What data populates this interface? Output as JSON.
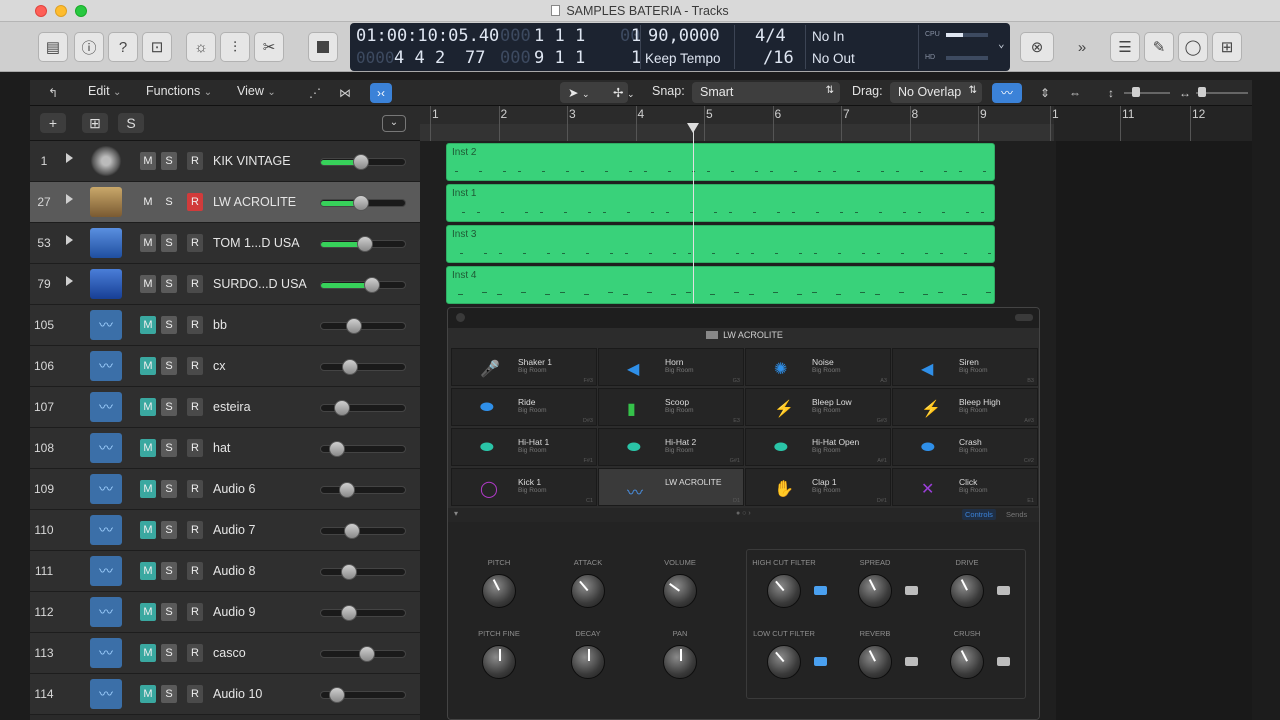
{
  "window": {
    "title": "SAMPLES BATERIA  - Tracks"
  },
  "lcd": {
    "time": "01:00:10:05.40",
    "time_dim": "0000",
    "bars": "1  1  1",
    "bars_end": "1",
    "position": "4  4  2",
    "ticks": "77",
    "pos_dim": "000",
    "pos_bar2": "9  1  1",
    "pos_end2": "1",
    "tempo": "90,0000",
    "tempo_mode": "Keep Tempo",
    "signature": "4/4",
    "division": "/16",
    "midi_in": "No In",
    "midi_out": "No Out",
    "cpu": "CPU",
    "hd": "HD"
  },
  "toolbar": {
    "edit": "Edit",
    "functions": "Functions",
    "view": "View",
    "snap_label": "Snap:",
    "snap_value": "Smart",
    "drag_label": "Drag:",
    "drag_value": "No Overlap"
  },
  "header": {
    "add": "+",
    "add_folder": "⊞",
    "s": "S"
  },
  "tracks": [
    {
      "num": "1",
      "name": "KIK VINTAGE",
      "m": "M",
      "s": "S",
      "r": "R",
      "level": 0.47
    },
    {
      "num": "27",
      "name": "LW ACROLITE",
      "m": "M",
      "s": "S",
      "r": "R",
      "level": 0.47
    },
    {
      "num": "53",
      "name": "TOM 1...D USA",
      "m": "M",
      "s": "S",
      "r": "R",
      "level": 0.51
    },
    {
      "num": "79",
      "name": "SURDO...D USA",
      "m": "M",
      "s": "S",
      "r": "R",
      "level": 0.59
    },
    {
      "num": "105",
      "name": "bb",
      "m": "M",
      "s": "S",
      "r": "R",
      "level": 0.38
    },
    {
      "num": "106",
      "name": "cx",
      "m": "M",
      "s": "S",
      "r": "R",
      "level": 0.34
    },
    {
      "num": "107",
      "name": "esteira",
      "m": "M",
      "s": "S",
      "r": "R",
      "level": 0.24
    },
    {
      "num": "108",
      "name": "hat",
      "m": "M",
      "s": "S",
      "r": "R",
      "level": 0.19
    },
    {
      "num": "109",
      "name": "Audio 6",
      "m": "M",
      "s": "S",
      "r": "R",
      "level": 0.3
    },
    {
      "num": "110",
      "name": "Audio 7",
      "m": "M",
      "s": "S",
      "r": "R",
      "level": 0.36
    },
    {
      "num": "111",
      "name": "Audio 8",
      "m": "M",
      "s": "S",
      "r": "R",
      "level": 0.32
    },
    {
      "num": "112",
      "name": "Audio 9",
      "m": "M",
      "s": "S",
      "r": "R",
      "level": 0.32
    },
    {
      "num": "113",
      "name": "casco",
      "m": "M",
      "s": "S",
      "r": "R",
      "level": 0.54
    },
    {
      "num": "114",
      "name": "Audio 10",
      "m": "M",
      "s": "S",
      "r": "R",
      "level": 0.19
    }
  ],
  "ruler": [
    "1",
    "2",
    "3",
    "4",
    "5",
    "6",
    "7",
    "8",
    "9",
    "1",
    "11",
    "12"
  ],
  "regions": [
    "Inst 2",
    "Inst 1",
    "Inst 3",
    "Inst 4"
  ],
  "plugin": {
    "header": "LW ACROLITE",
    "pads": [
      {
        "name": "Shaker 1",
        "sub": "Big Room",
        "note": "F#3",
        "icon": "shaker-icon",
        "color": "#9a3ed8"
      },
      {
        "name": "Horn",
        "sub": "Big Room",
        "note": "G3",
        "icon": "horn-icon",
        "color": "#2f8fe8"
      },
      {
        "name": "Noise",
        "sub": "Big Room",
        "note": "A3",
        "icon": "noise-icon",
        "color": "#2f8fe8"
      },
      {
        "name": "Siren",
        "sub": "Big Room",
        "note": "B3",
        "icon": "siren-icon",
        "color": "#2f8fe8"
      },
      {
        "name": "Ride",
        "sub": "Big Room",
        "note": "D#3",
        "icon": "ride-icon",
        "color": "#2f8fe8"
      },
      {
        "name": "Scoop",
        "sub": "Big Room",
        "note": "E3",
        "icon": "scoop-icon",
        "color": "#35c24a"
      },
      {
        "name": "Bleep Low",
        "sub": "Big Room",
        "note": "G#3",
        "icon": "bleep-low-icon",
        "color": "#2f8fe8"
      },
      {
        "name": "Bleep High",
        "sub": "Big Room",
        "note": "A#3",
        "icon": "bleep-high-icon",
        "color": "#2f8fe8"
      },
      {
        "name": "Hi-Hat 1",
        "sub": "Big Room",
        "note": "F#1",
        "icon": "hihat-icon",
        "color": "#2ac4a7"
      },
      {
        "name": "Hi-Hat 2",
        "sub": "Big Room",
        "note": "G#1",
        "icon": "hihat-icon",
        "color": "#2ac4a7"
      },
      {
        "name": "Hi-Hat Open",
        "sub": "Big Room",
        "note": "A#1",
        "icon": "hihat-open-icon",
        "color": "#2ac4a7"
      },
      {
        "name": "Crash",
        "sub": "Big Room",
        "note": "C#2",
        "icon": "crash-icon",
        "color": "#2f8fe8"
      },
      {
        "name": "Kick 1",
        "sub": "Big Room",
        "note": "C1",
        "icon": "kick-icon",
        "color": "#b03ac8"
      },
      {
        "name": "LW ACROLITE",
        "sub": "",
        "note": "D1",
        "icon": "waveform-icon",
        "color": "#4a90e2"
      },
      {
        "name": "Clap 1",
        "sub": "Big Room",
        "note": "D#1",
        "icon": "clap-icon",
        "color": "#e09a2a"
      },
      {
        "name": "Click",
        "sub": "Big Room",
        "note": "E1",
        "icon": "click-icon",
        "color": "#9a3ed8"
      }
    ],
    "tabs": {
      "controls": "Controls",
      "sends": "Sends"
    },
    "knobs_left": [
      {
        "label": "PITCH",
        "value": -0.2
      },
      {
        "label": "ATTACK",
        "value": -0.3
      },
      {
        "label": "VOLUME",
        "value": -0.4
      },
      {
        "label": "PITCH FINE",
        "value": 0
      },
      {
        "label": "DECAY",
        "value": 0
      },
      {
        "label": "PAN",
        "value": 0
      }
    ],
    "knobs_right": [
      {
        "label": "HIGH CUT FILTER",
        "value": -0.3,
        "toggle": true
      },
      {
        "label": "SPREAD",
        "value": -0.2,
        "toggle": false
      },
      {
        "label": "DRIVE",
        "value": -0.2,
        "toggle": false
      },
      {
        "label": "LOW CUT FILTER",
        "value": -0.3,
        "toggle": true
      },
      {
        "label": "REVERB",
        "value": -0.2,
        "toggle": false
      },
      {
        "label": "CRUSH",
        "value": -0.2,
        "toggle": false
      }
    ]
  },
  "colors": {
    "region": "#39d27a",
    "accent_blue": "#3b82d8",
    "record": "#d13b3b",
    "monitor": "#4aa0d8"
  }
}
